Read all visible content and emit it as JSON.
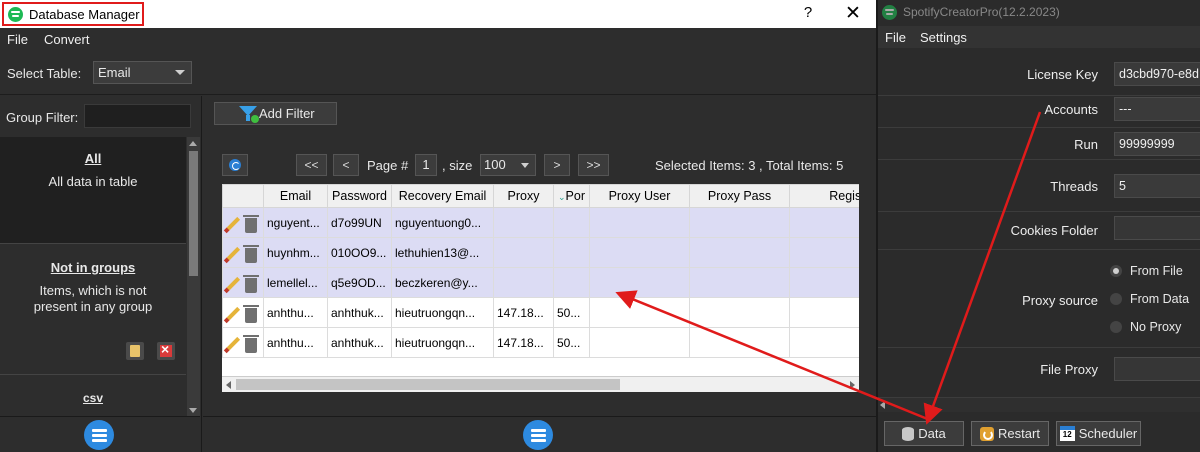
{
  "db_window": {
    "title": "Database Manager",
    "help_label": "?",
    "close_label": "✕",
    "menu": [
      "File",
      "Convert"
    ],
    "select_table_label": "Select Table:",
    "select_table_value": "Email",
    "group_filter_label": "Group Filter:",
    "groups": [
      {
        "title": "All",
        "description": "All data in table"
      },
      {
        "title": "Not in groups",
        "description": "Items, which is not present in any group"
      },
      {
        "title": "csv",
        "description": ""
      }
    ],
    "add_filter_label": "Add Filter",
    "pager": {
      "first": "<<",
      "prev": "<",
      "page_label": "Page #",
      "page_value": "1",
      "size_label": ", size",
      "size_value": "100",
      "next": ">",
      "last": ">>"
    },
    "selection_info": "Selected Items:  3  ,  Total Items:  5",
    "grid": {
      "columns": [
        "",
        "Email",
        "Password",
        "Recovery Email",
        "Proxy",
        "Por",
        "Proxy User",
        "Proxy Pass",
        "Registere"
      ],
      "rows": [
        {
          "selected": true,
          "cells": [
            "nguyent...",
            "d7o99UN",
            "nguyentuong0...",
            "",
            "",
            "",
            "",
            ""
          ]
        },
        {
          "selected": true,
          "cells": [
            "huynhm...",
            "010OO9...",
            "lethuhien13@...",
            "",
            "",
            "",
            "",
            ""
          ]
        },
        {
          "selected": true,
          "cells": [
            "lemellel...",
            "q5e9OD...",
            "beczkeren@y...",
            "",
            "",
            "",
            "",
            ""
          ]
        },
        {
          "selected": false,
          "cells": [
            "anhthu...",
            "anhthuk...",
            "hieutruongqn...",
            "147.18...",
            "50...",
            "",
            "",
            ""
          ]
        },
        {
          "selected": false,
          "cells": [
            "anhthu...",
            "anhthuk...",
            "hieutruongqn...",
            "147.18...",
            "50...",
            "",
            "",
            ""
          ]
        }
      ]
    }
  },
  "sp_window": {
    "title": "SpotifyCreatorPro(12.2.2023)",
    "menu": [
      "File",
      "Settings"
    ],
    "fields": {
      "license_key": {
        "label": "License Key",
        "value": "d3cbd970-e8d"
      },
      "accounts": {
        "label": "Accounts",
        "value": "---"
      },
      "run": {
        "label": "Run",
        "value": "99999999"
      },
      "threads": {
        "label": "Threads",
        "value": "5"
      },
      "cookies_folder": {
        "label": "Cookies Folder",
        "value": ""
      },
      "proxy_source": {
        "label": "Proxy source",
        "options": [
          "From File",
          "From Data",
          "No Proxy"
        ],
        "selected": "From File"
      },
      "file_proxy": {
        "label": "File Proxy",
        "value": ""
      }
    },
    "buttons": {
      "data": "Data",
      "restart": "Restart",
      "scheduler": "Scheduler",
      "calendar_day": "12"
    }
  },
  "annotation_color": "#e01b1b"
}
